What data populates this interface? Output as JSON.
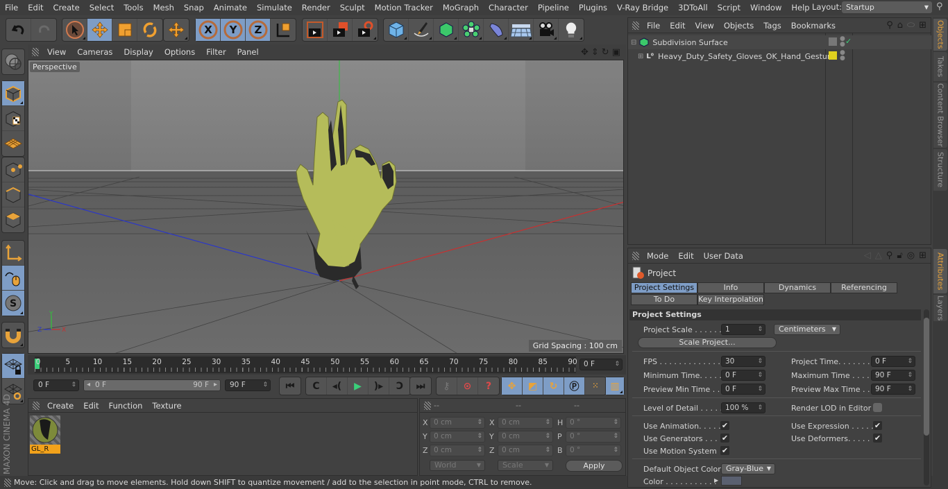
{
  "menu": [
    "File",
    "Edit",
    "Create",
    "Select",
    "Tools",
    "Mesh",
    "Snap",
    "Animate",
    "Simulate",
    "Render",
    "Sculpt",
    "Motion Tracker",
    "MoGraph",
    "Character",
    "Pipeline",
    "Plugins",
    "V-Ray Bridge",
    "3DToAll",
    "Script",
    "Window",
    "Help"
  ],
  "layout": {
    "label": "Layout:",
    "value": "Startup"
  },
  "toolbar": {
    "groups": [
      {
        "items": [
          "undo-icon",
          "redo-icon"
        ]
      },
      {
        "items": [
          "live-selection-icon",
          "move-icon",
          "scale-icon",
          "rotate-icon"
        ],
        "active": [
          1
        ]
      },
      {
        "items": [
          "recent-tools-icon"
        ]
      },
      {
        "items": [
          "x-axis-lock-icon",
          "y-axis-lock-icon",
          "z-axis-lock-icon",
          "coordinate-system-icon"
        ],
        "active": [
          0,
          1,
          2
        ]
      },
      {
        "items": [
          "render-view-icon",
          "render-picture-viewer-icon",
          "render-settings-icon"
        ]
      },
      {
        "items": [
          "cube-primitive-icon",
          "pen-spline-icon",
          "subdivision-surface-icon",
          "cloner-icon",
          "deformer-icon",
          "floor-icon",
          "camera-icon",
          "light-icon"
        ]
      }
    ]
  },
  "viewport": {
    "menu": [
      "View",
      "Cameras",
      "Display",
      "Options",
      "Filter",
      "Panel"
    ],
    "camera_label": "Perspective",
    "grid_spacing": "Grid Spacing : 100 cm",
    "axis": {
      "x": "X",
      "y": "Y",
      "z": "Z"
    }
  },
  "timeline": {
    "ticks": [
      "0",
      "5",
      "10",
      "15",
      "20",
      "25",
      "30",
      "35",
      "40",
      "45",
      "50",
      "55",
      "60",
      "65",
      "70",
      "75",
      "80",
      "85",
      "90"
    ],
    "current_frame": "0 F",
    "start": "0 F",
    "range_start": "0 F",
    "range_end": "90 F",
    "end": "90 F"
  },
  "materials": {
    "menu": [
      "Create",
      "Edit",
      "Function",
      "Texture"
    ],
    "items": [
      {
        "name": "GL_R"
      }
    ]
  },
  "coordinates": {
    "headers": [
      "--",
      "--",
      "--"
    ],
    "rows": [
      {
        "l1": "X",
        "v1": "0 cm",
        "l2": "X",
        "v2": "0 cm",
        "l3": "H",
        "v3": "0 °"
      },
      {
        "l1": "Y",
        "v1": "0 cm",
        "l2": "Y",
        "v2": "0 cm",
        "l3": "P",
        "v3": "0 °"
      },
      {
        "l1": "Z",
        "v1": "0 cm",
        "l2": "Z",
        "v2": "0 cm",
        "l3": "B",
        "v3": "0 °"
      }
    ],
    "mode": "World",
    "size_mode": "Scale",
    "apply": "Apply"
  },
  "status": "Move: Click and drag to move elements. Hold down SHIFT to quantize movement / add to the selection in point mode, CTRL to remove.",
  "objects": {
    "menu": [
      "File",
      "Edit",
      "View",
      "Objects",
      "Tags",
      "Bookmarks"
    ],
    "items": [
      {
        "name": "Subdivision Surface"
      },
      {
        "name": "Heavy_Duty_Safety_Gloves_OK_Hand_Gesture"
      }
    ]
  },
  "attributes": {
    "menu": [
      "Mode",
      "Edit",
      "User Data"
    ],
    "object": "Project",
    "tabs": [
      "Project Settings",
      "Info",
      "Dynamics",
      "Referencing",
      "To Do",
      "Key Interpolation"
    ],
    "section": "Project Settings",
    "project_scale": {
      "label": "Project Scale . . . . . .",
      "value": "1",
      "unit": "Centimeters"
    },
    "scale_project": "Scale Project...",
    "fps": {
      "label": "FPS . . . . . . . . . . . . . .",
      "value": "30"
    },
    "project_time": {
      "label": "Project Time. . . . . . . .",
      "value": "0 F"
    },
    "min_time": {
      "label": "Minimum Time. . . . .",
      "value": "0 F"
    },
    "max_time": {
      "label": "Maximum Time . . . . .",
      "value": "90 F"
    },
    "preview_min": {
      "label": "Preview Min Time . .",
      "value": "0 F"
    },
    "preview_max": {
      "label": "Preview Max Time . . .",
      "value": "90 F"
    },
    "lod": {
      "label": "Level of Detail . . . . .",
      "value": "100 %"
    },
    "render_lod": {
      "label": "Render LOD in Editor",
      "checked": false
    },
    "use_animation": {
      "label": "Use Animation. . . . .",
      "checked": true
    },
    "use_expression": {
      "label": "Use Expression . . . . .",
      "checked": true
    },
    "use_generators": {
      "label": "Use Generators . . . .",
      "checked": true
    },
    "use_deformers": {
      "label": "Use Deformers. . . . . .",
      "checked": true
    },
    "use_motion": {
      "label": "Use Motion System",
      "checked": true
    },
    "default_color": {
      "label": "Default Object Color",
      "value": "Gray-Blue"
    },
    "color": {
      "label": "Color . . . . . . . . . . .",
      "swatch": "#5a6070"
    }
  },
  "right_tabs": {
    "top": [
      "Objects",
      "Takes",
      "Content Browser",
      "Structure"
    ],
    "bottom": [
      "Attributes",
      "Layers"
    ]
  },
  "colors": {
    "accent": "#7e9dc6",
    "orange": "#e8a33a",
    "glove": "#b5bc5a"
  },
  "branding": "MAXON CINEMA 4D"
}
